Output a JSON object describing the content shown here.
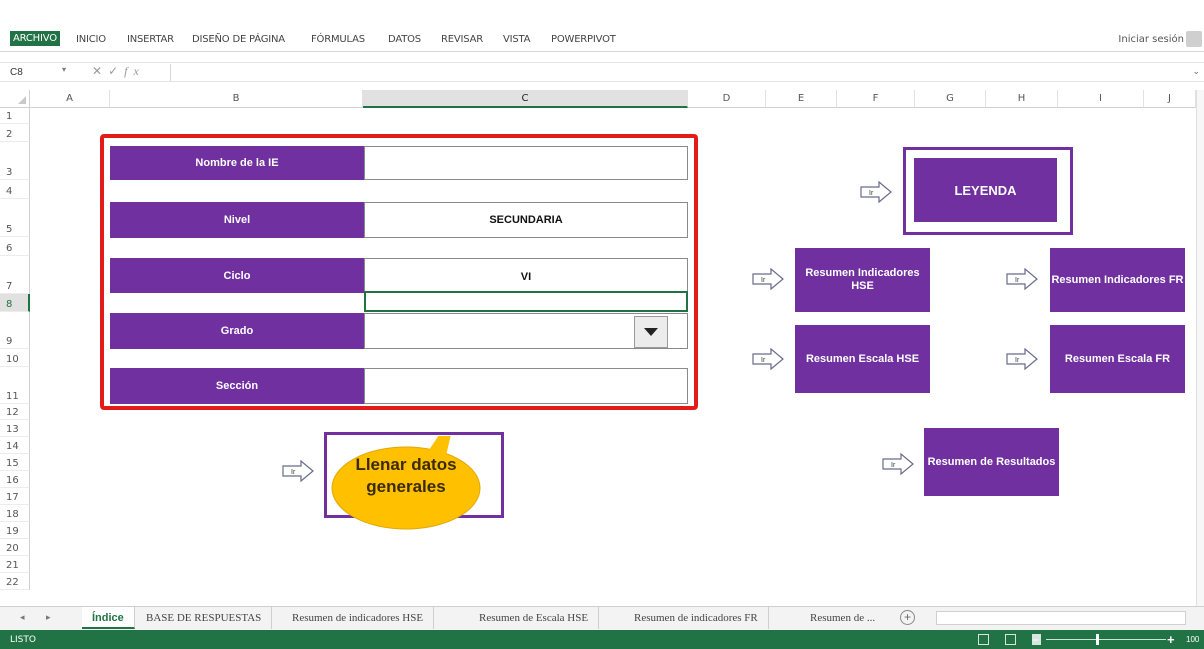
{
  "ribbon": {
    "file_tab": "ARCHIVO",
    "tabs": [
      "INICIO",
      "INSERTAR",
      "DISEÑO DE PÁGINA",
      "FÓRMULAS",
      "DATOS",
      "REVISAR",
      "VISTA",
      "POWERPIVOT"
    ],
    "signin": "Iniciar sesión"
  },
  "formula_bar": {
    "name_box": "C8",
    "fx_label": "fx",
    "content": ""
  },
  "columns": [
    "A",
    "B",
    "C",
    "D",
    "E",
    "F",
    "G",
    "H",
    "I",
    "J"
  ],
  "selected_column": "C",
  "rows": [
    "1",
    "2",
    "3",
    "4",
    "5",
    "6",
    "7",
    "8",
    "9",
    "10",
    "11",
    "12",
    "13",
    "14",
    "15",
    "16",
    "17",
    "18",
    "19",
    "20",
    "21",
    "22"
  ],
  "selected_row": "8",
  "form": {
    "fields": [
      {
        "label": "Nombre de la IE",
        "value": ""
      },
      {
        "label": "Nivel",
        "value": "SECUNDARIA"
      },
      {
        "label": "Ciclo",
        "value": "VI"
      },
      {
        "label": "Grado",
        "value": ""
      },
      {
        "label": "Sección",
        "value": ""
      }
    ]
  },
  "callout": {
    "line1": "Llenar datos",
    "line2": "generales"
  },
  "nav": {
    "ir_label": "Ir",
    "leyenda": "LEYENDA",
    "resumen_ind_hse": "Resumen Indicadores HSE",
    "resumen_ind_fr": "Resumen Indicadores FR",
    "resumen_esc_hse": "Resumen Escala HSE",
    "resumen_esc_fr": "Resumen Escala FR",
    "resumen_resultados": "Resumen de Resultados"
  },
  "sheets": {
    "tabs": [
      "Índice",
      "BASE DE RESPUESTAS",
      "Resumen de indicadores HSE",
      "Resumen de Escala HSE",
      "Resumen de indicadores FR",
      "Resumen de ..."
    ],
    "active": "Índice",
    "add": "+"
  },
  "status": {
    "ready": "LISTO",
    "zoom": "100"
  },
  "colors": {
    "excel_green": "#217346",
    "purple": "#7030a0",
    "red_outline": "#e31b1b",
    "callout_yellow": "#ffc000"
  }
}
